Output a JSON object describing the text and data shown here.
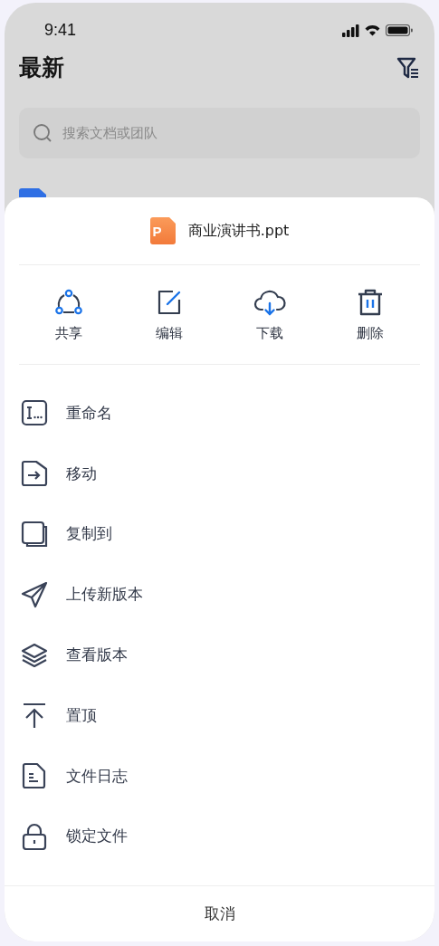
{
  "status_bar": {
    "time": "9:41"
  },
  "page": {
    "title": "最新",
    "search": {
      "placeholder": "搜索文档或团队"
    }
  },
  "sheet": {
    "file_name": "商业演讲书.ppt",
    "file_badge": "P",
    "actions": [
      {
        "kind": "share",
        "label": "共享"
      },
      {
        "kind": "edit",
        "label": "编辑"
      },
      {
        "kind": "download",
        "label": "下载"
      },
      {
        "kind": "delete",
        "label": "删除"
      }
    ],
    "menu": [
      {
        "kind": "rename",
        "label": "重命名"
      },
      {
        "kind": "move",
        "label": "移动"
      },
      {
        "kind": "copy",
        "label": "复制到"
      },
      {
        "kind": "upload",
        "label": "上传新版本"
      },
      {
        "kind": "versions",
        "label": "查看版本"
      },
      {
        "kind": "pin",
        "label": "置顶"
      },
      {
        "kind": "log",
        "label": "文件日志"
      },
      {
        "kind": "lock",
        "label": "锁定文件"
      }
    ],
    "cancel": "取消"
  }
}
